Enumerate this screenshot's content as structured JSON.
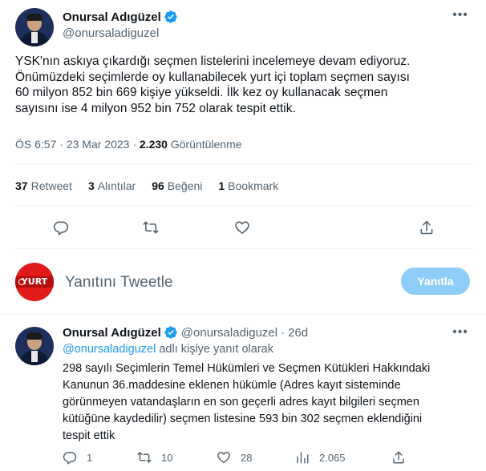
{
  "main_tweet": {
    "author_name": "Onursal Adıgüzel",
    "author_handle": "@onursaladiguzel",
    "verified": true,
    "text_lines": [
      "YSK'nın askıya çıkardığı seçmen listelerini incelemeye devam ediyoruz.",
      "Önümüzdeki seçimlerde oy kullanabilecek yurt içi toplam seçmen sayısı",
      "60 milyon 852 bin 669 kişiye yükseldi. İlk kez oy kullanacak seçmen",
      "sayısını ise 4 milyon 952 bin 752 olarak tespit ettik."
    ],
    "time": "ÖS 6:57",
    "date": "23 Mar 2023",
    "views_count": "2.230",
    "views_label": "Görüntülenme",
    "stats": {
      "retweets_count": "37",
      "retweets_label": "Retweet",
      "quotes_count": "3",
      "quotes_label": "Alıntılar",
      "likes_count": "96",
      "likes_label": "Beğeni",
      "bookmarks_count": "1",
      "bookmarks_label": "Bookmark"
    }
  },
  "reply_box": {
    "placeholder": "Yanıtını Tweetle",
    "button_label": "Yanıtla",
    "avatar_text": "YURT"
  },
  "reply_tweet": {
    "author_name": "Onursal Adıgüzel",
    "author_handle": "@onursaladiguzel",
    "separator": "·",
    "age": "26d",
    "replying_to_handle": "@onursaladiguzel",
    "replying_to_suffix": "adlı kişiye yanıt olarak",
    "text_lines": [
      "298 sayılı Seçimlerin Temel Hükümleri ve Seçmen Kütükleri Hakkındaki",
      "Kanunun 36.maddesine eklenen hükümle (Adres kayıt sisteminde",
      "görünmeyen vatandaşların en son geçerli adres kayıt bilgileri seçmen",
      "kütüğüne kaydedilir) seçmen listesine 593 bin 302 seçmen eklendiğini",
      "tespit ettik"
    ],
    "reply_count": "1",
    "retweet_count": "10",
    "like_count": "28",
    "view_count": "2.065"
  },
  "colors": {
    "accent": "#1d9bf0",
    "secondary_text": "#536471",
    "primary_text": "#0f1419",
    "reply_button_bg": "#8ecdf7",
    "divider": "#eff3f4"
  },
  "icons": [
    "verified-badge-icon",
    "more-icon",
    "reply-icon",
    "retweet-icon",
    "like-icon",
    "share-icon",
    "views-icon"
  ]
}
